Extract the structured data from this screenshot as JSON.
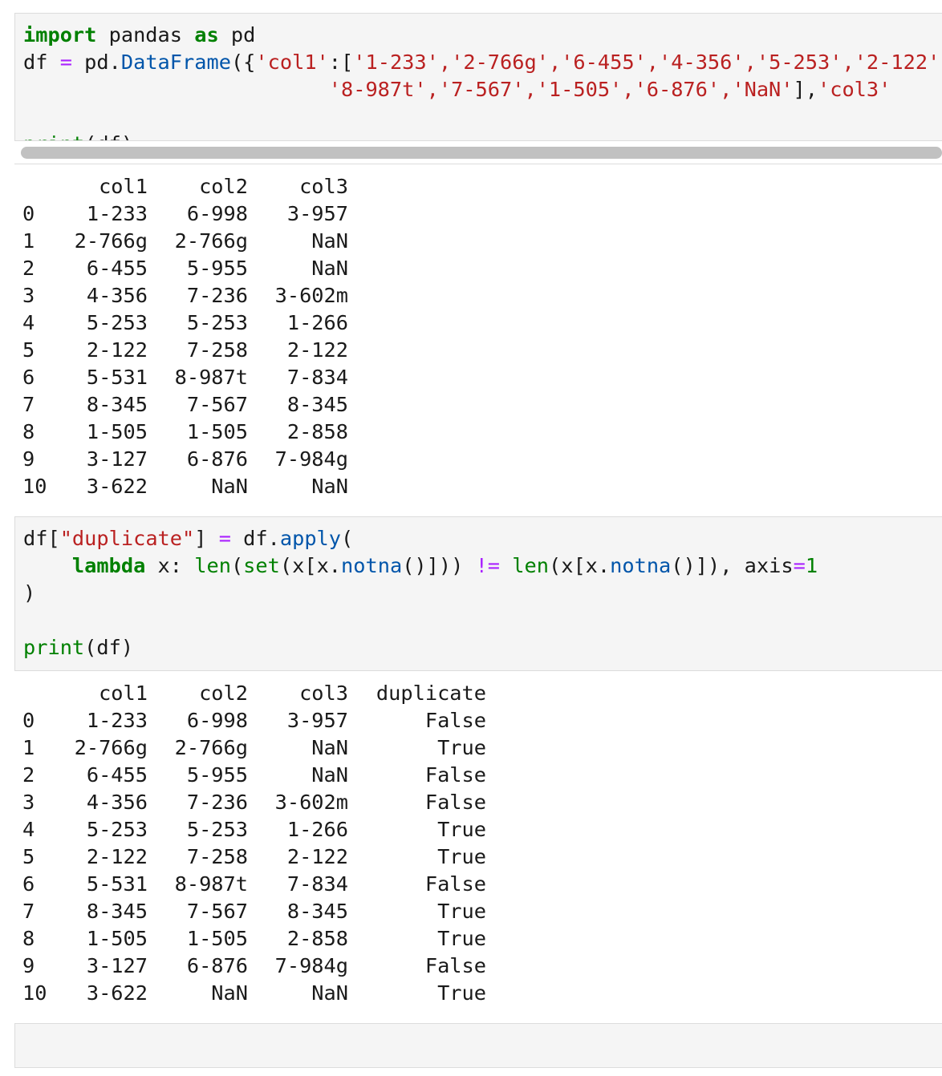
{
  "cell1": {
    "code_line1": [
      "import",
      " pandas ",
      "as",
      " pd"
    ],
    "code_line2_prefix": "df ",
    "code_line2_eq": "=",
    "code_line2_mid": " pd.",
    "code_line2_cls": "DataFrame",
    "code_line2_open": "({",
    "code_line2_key": "'col1'",
    "code_line2_colon": ":[",
    "code_line2_values": "'1-233','2-766g','6-455','4-356','5-253','2-122'",
    "code_line3_indent": "                         ",
    "code_line3_values": "'8-987t','7-567','1-505','6-876','NaN'",
    "code_line3_close": "],",
    "code_line3_key": "'col3'",
    "code_line5_fn": "print",
    "code_line5_rest": "(df)"
  },
  "output1": {
    "headers": [
      "",
      "col1",
      "col2",
      "col3"
    ],
    "rows": [
      [
        "0",
        "1-233",
        "6-998",
        "3-957"
      ],
      [
        "1",
        "2-766g",
        "2-766g",
        "NaN"
      ],
      [
        "2",
        "6-455",
        "5-955",
        "NaN"
      ],
      [
        "3",
        "4-356",
        "7-236",
        "3-602m"
      ],
      [
        "4",
        "5-253",
        "5-253",
        "1-266"
      ],
      [
        "5",
        "2-122",
        "7-258",
        "2-122"
      ],
      [
        "6",
        "5-531",
        "8-987t",
        "7-834"
      ],
      [
        "7",
        "8-345",
        "7-567",
        "8-345"
      ],
      [
        "8",
        "1-505",
        "1-505",
        "2-858"
      ],
      [
        "9",
        "3-127",
        "6-876",
        "7-984g"
      ],
      [
        "10",
        "3-622",
        "NaN",
        "NaN"
      ]
    ]
  },
  "cell2": {
    "l1_a": "df[",
    "l1_str": "\"duplicate\"",
    "l1_b": "] ",
    "l1_eq": "=",
    "l1_c": " df.",
    "l1_attr": "apply",
    "l1_d": "(",
    "l2_indent": "    ",
    "l2_kw": "lambda",
    "l2_a": " x: ",
    "l2_len1": "len",
    "l2_b": "(",
    "l2_set": "set",
    "l2_c": "(x[x.",
    "l2_notna1": "notna",
    "l2_d": "()])) ",
    "l2_neq": "!=",
    "l2_e": " ",
    "l2_len2": "len",
    "l2_f": "(x[x.",
    "l2_notna2": "notna",
    "l2_g": "()]), axis",
    "l2_eq": "=",
    "l2_num": "1",
    "l3": ")",
    "l5_fn": "print",
    "l5_rest": "(df)"
  },
  "output2": {
    "headers": [
      "",
      "col1",
      "col2",
      "col3",
      "duplicate"
    ],
    "rows": [
      [
        "0",
        "1-233",
        "6-998",
        "3-957",
        "False"
      ],
      [
        "1",
        "2-766g",
        "2-766g",
        "NaN",
        "True"
      ],
      [
        "2",
        "6-455",
        "5-955",
        "NaN",
        "False"
      ],
      [
        "3",
        "4-356",
        "7-236",
        "3-602m",
        "False"
      ],
      [
        "4",
        "5-253",
        "5-253",
        "1-266",
        "True"
      ],
      [
        "5",
        "2-122",
        "7-258",
        "2-122",
        "True"
      ],
      [
        "6",
        "5-531",
        "8-987t",
        "7-834",
        "False"
      ],
      [
        "7",
        "8-345",
        "7-567",
        "8-345",
        "True"
      ],
      [
        "8",
        "1-505",
        "1-505",
        "2-858",
        "True"
      ],
      [
        "9",
        "3-127",
        "6-876",
        "7-984g",
        "False"
      ],
      [
        "10",
        "3-622",
        "NaN",
        "NaN",
        "True"
      ]
    ]
  },
  "cell3": {
    "code": ""
  }
}
